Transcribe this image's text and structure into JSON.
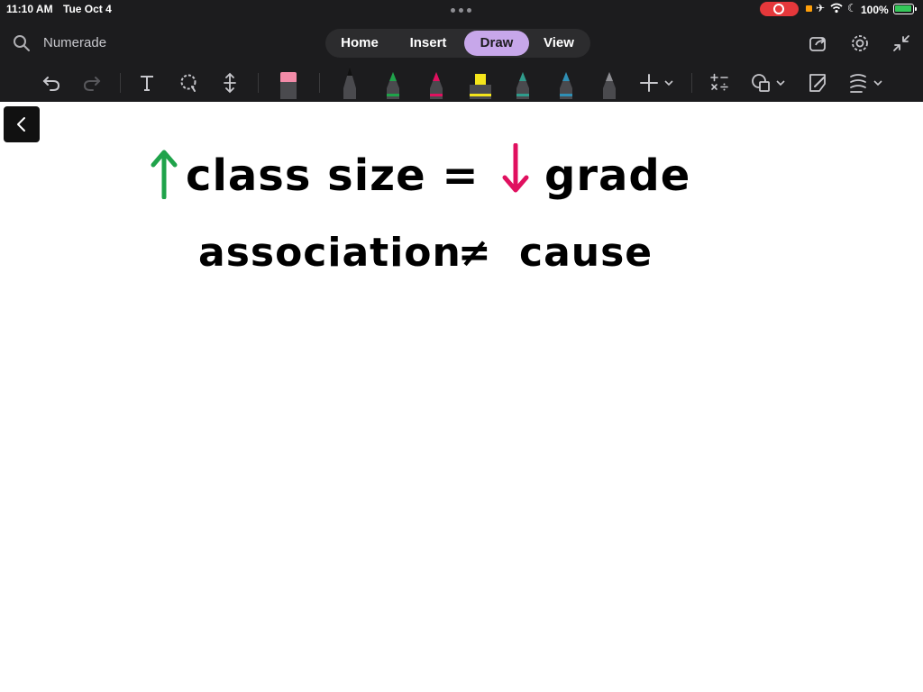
{
  "status": {
    "time": "11:10 AM",
    "date": "Tue Oct 4",
    "battery": "100%"
  },
  "header": {
    "title": "Numerade",
    "tabs": [
      {
        "label": "Home"
      },
      {
        "label": "Insert"
      },
      {
        "label": "Draw",
        "active": true
      },
      {
        "label": "View"
      }
    ]
  },
  "toolbar": {
    "tools": [
      "undo-icon",
      "redo-icon",
      "text-tool-icon",
      "lasso-icon",
      "space-insert-icon",
      "eraser-icon"
    ],
    "pens": [
      {
        "name": "black-pen",
        "color": "#111111"
      },
      {
        "name": "green-pen",
        "color": "#1fa34a"
      },
      {
        "name": "magenta-pen",
        "color": "#e0105f"
      },
      {
        "name": "yellow-highlighter",
        "color": "#f5e51b"
      },
      {
        "name": "teal-pen",
        "color": "#2f9c8c"
      },
      {
        "name": "blue-pen",
        "color": "#2f8fb5"
      },
      {
        "name": "gray-pencil",
        "color": "#6e6e73"
      }
    ],
    "right_tools": [
      "add-pen-icon",
      "math-icon",
      "shapes-icon",
      "ink-to-shape-icon",
      "ruler-icon"
    ]
  },
  "canvas": {
    "line1": {
      "up_arrow_color": "#1fa34a",
      "text_a": "class size =",
      "down_arrow_color": "#e0105f",
      "text_b": "grade"
    },
    "line2": {
      "text_a": "association",
      "symbol": "≠",
      "text_b": "cause"
    }
  }
}
